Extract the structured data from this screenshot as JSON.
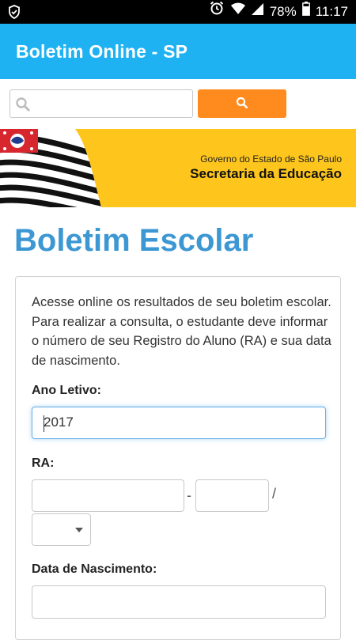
{
  "status_bar": {
    "battery": "78%",
    "time": "11:17",
    "icons": [
      "shield-icon",
      "alarm-icon",
      "wifi-icon",
      "signal-icon",
      "battery-icon"
    ]
  },
  "app_bar": {
    "title": "Boletim Online - SP"
  },
  "search": {
    "placeholder": "",
    "button_icon": "search-icon",
    "button_color": "#ff8a1e"
  },
  "banner": {
    "government": "Governo do Estado de São Paulo",
    "secretariat": "Secretaria da Educação",
    "background": "#fec61d"
  },
  "main": {
    "title": "Boletim Escolar",
    "intro": "Acesse online os resultados de seu boletim escolar. Para realizar a consulta, o estudante deve informar o número de seu Registro do Aluno (RA) e sua data de nascimento.",
    "ano_letivo": {
      "label": "Ano Letivo:",
      "value": "2017"
    },
    "ra": {
      "label": "RA:",
      "number": "",
      "digit": "",
      "separator_dash": "-",
      "separator_slash": "/",
      "uf_selected": ""
    },
    "nascimento": {
      "label": "Data de Nascimento:",
      "value": ""
    }
  },
  "colors": {
    "app_bar": "#1fb2f2",
    "title": "#3c97d3",
    "focus": "#66afe9"
  }
}
